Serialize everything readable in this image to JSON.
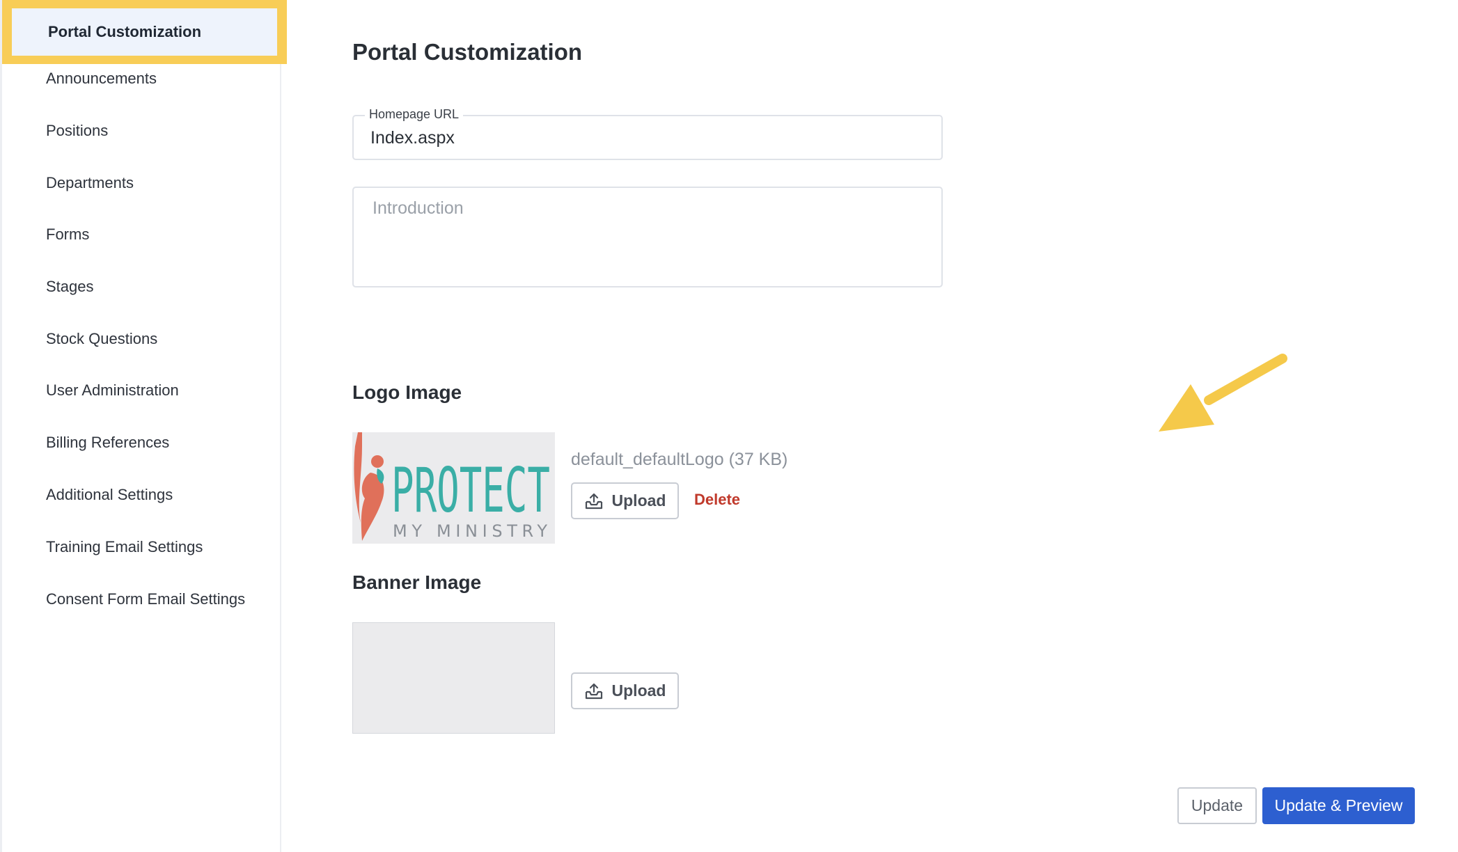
{
  "sidebar": {
    "items": [
      {
        "label": "Portal Customization",
        "active": true
      },
      {
        "label": "Announcements"
      },
      {
        "label": "Positions"
      },
      {
        "label": "Departments"
      },
      {
        "label": "Forms"
      },
      {
        "label": "Stages"
      },
      {
        "label": "Stock Questions"
      },
      {
        "label": "User Administration"
      },
      {
        "label": "Billing References"
      },
      {
        "label": "Additional Settings"
      },
      {
        "label": "Training Email Settings"
      },
      {
        "label": "Consent Form Email Settings"
      }
    ]
  },
  "main": {
    "title": "Portal Customization",
    "homepage_url": {
      "label": "Homepage URL",
      "value": "Index.aspx"
    },
    "introduction": {
      "placeholder": "Introduction"
    },
    "logo": {
      "title": "Logo Image",
      "file_name": "default_defaultLogo (37 KB)",
      "upload_label": "Upload",
      "delete_label": "Delete",
      "logo_text": "PROTECT",
      "logo_subtext": "MY MINISTRY"
    },
    "banner": {
      "title": "Banner Image",
      "upload_label": "Upload"
    }
  },
  "footer": {
    "update_label": "Update",
    "update_preview_label": "Update & Preview"
  },
  "colors": {
    "highlight": "#f8cd57",
    "primary_button": "#2d5fd0",
    "delete": "#c0392b",
    "logo_teal": "#3aaea6",
    "logo_coral": "#e0705a"
  },
  "icons": {
    "upload": "upload-tray-icon",
    "annotation": "yellow-arrow"
  }
}
